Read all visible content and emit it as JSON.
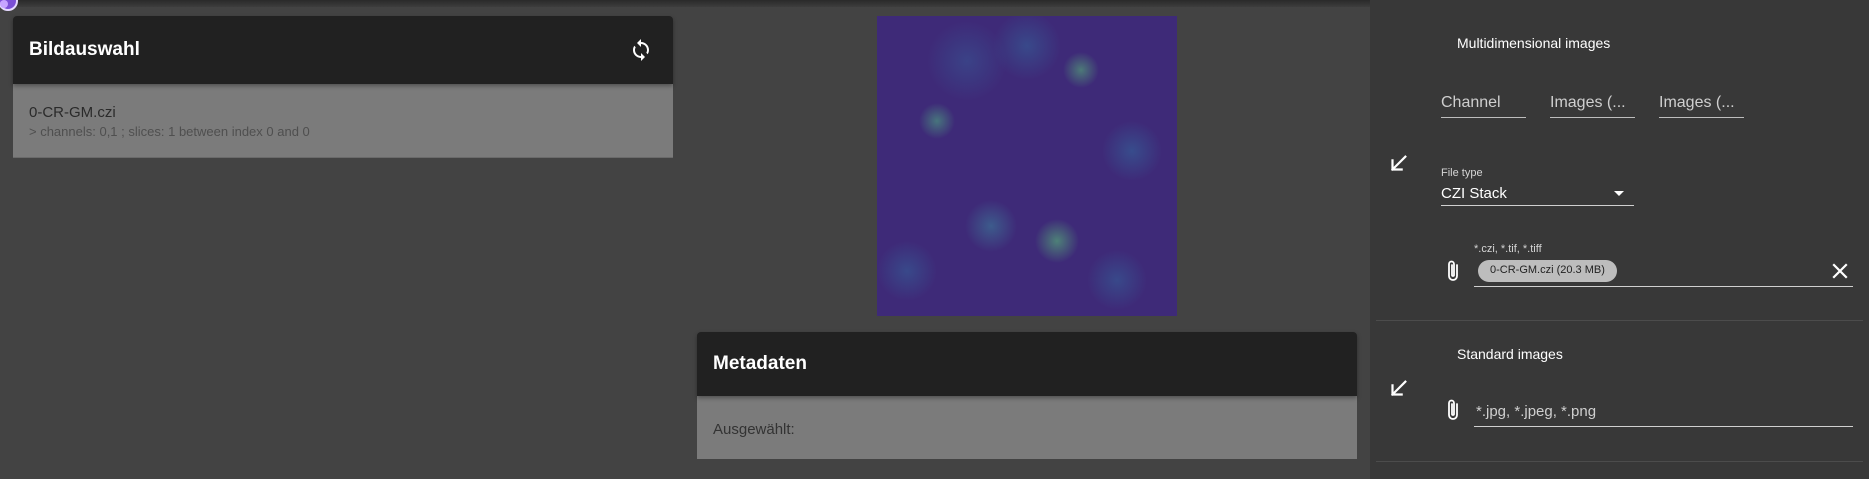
{
  "icons": {
    "logo": "app-logo-icon",
    "refresh": "refresh-icon",
    "arrow": "arrow-down-left-icon",
    "attach": "paperclip-icon",
    "close": "close-icon"
  },
  "colors": {
    "header_bg": "#212121",
    "item_bg": "#7b7b7b",
    "page_bg": "#434343",
    "right_panel_bg": "#383838",
    "logo_accent": "#7b4fd6"
  },
  "image_selection": {
    "title": "Bildauswahl",
    "items": [
      {
        "name": "0-CR-GM.czi",
        "details": "> channels: 0,1 ; slices: 1 between index 0 and 0"
      }
    ]
  },
  "metadata": {
    "title": "Metadaten",
    "selected_label": "Ausgewählt:"
  },
  "multidimensional": {
    "title": "Multidimensional images",
    "fields": [
      {
        "label": "Channel"
      },
      {
        "label": "Images (..."
      },
      {
        "label": "Images (..."
      }
    ],
    "file_type": {
      "label": "File type",
      "value": "CZI Stack"
    },
    "file_input": {
      "accept_label": "*.czi, *.tif, *.tiff",
      "chip": "0-CR-GM.czi (20.3 MB)"
    }
  },
  "standard": {
    "title": "Standard images",
    "file_input": {
      "placeholder": "*.jpg, *.jpeg, *.png"
    }
  }
}
